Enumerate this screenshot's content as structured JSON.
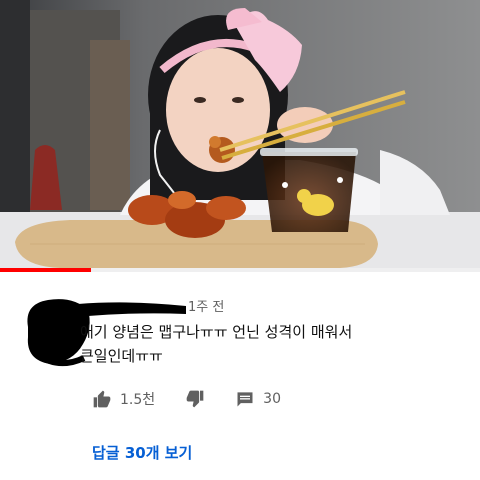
{
  "video": {
    "progress_fraction": 0.19
  },
  "comment": {
    "timestamp": "1주 전",
    "text": "애기 양념은 맵구나ㅠㅠ 언닌 성격이 매워서\n큰일인데ㅠㅠ",
    "like_count": "1.5천",
    "reply_count": "30",
    "view_replies_label": "답글 30개 보기"
  },
  "colors": {
    "progress": "#ff0000",
    "link": "#065fd4",
    "meta_text": "#606060"
  },
  "icons": {
    "like": "thumbs-up-icon",
    "dislike": "thumbs-down-icon",
    "reply": "comment-icon"
  }
}
